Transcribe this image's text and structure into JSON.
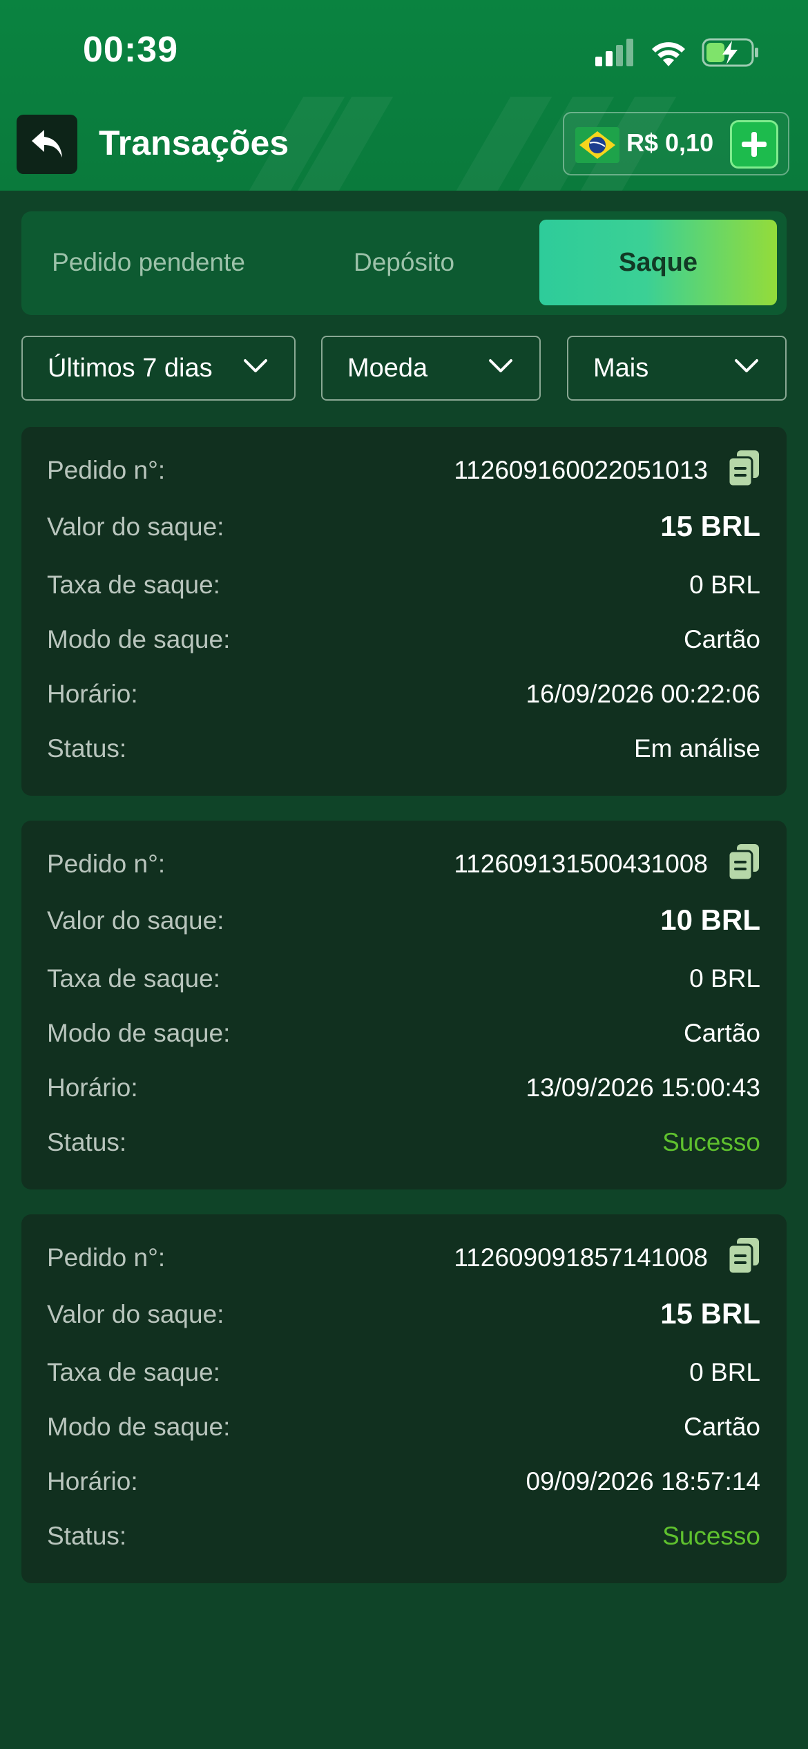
{
  "status_bar": {
    "time": "00:39"
  },
  "header": {
    "title": "Transações",
    "balance": "R$ 0,10",
    "back_icon": "back-arrow-icon",
    "add_icon": "plus-icon"
  },
  "tabs": [
    {
      "label": "Pedido pendente",
      "active": false
    },
    {
      "label": "Depósito",
      "active": false
    },
    {
      "label": "Saque",
      "active": true
    }
  ],
  "filters": [
    {
      "label": "Últimos 7 dias"
    },
    {
      "label": "Moeda"
    },
    {
      "label": "Mais"
    }
  ],
  "labels": {
    "order": "Pedido n°:",
    "amount": "Valor do saque:",
    "fee": "Taxa de saque:",
    "mode": "Modo de saque:",
    "time": "Horário:",
    "status": "Status:"
  },
  "transactions": [
    {
      "order": "112609160022051013",
      "amount": "15 BRL",
      "fee": "0 BRL",
      "mode": "Cartão",
      "time": "16/09/2026 00:22:06",
      "status": "Em análise"
    },
    {
      "order": "112609131500431008",
      "amount": "10 BRL",
      "fee": "0 BRL",
      "mode": "Cartão",
      "time": "13/09/2026 15:00:43",
      "status": "Sucesso"
    },
    {
      "order": "112609091857141008",
      "amount": "15 BRL",
      "fee": "0 BRL",
      "mode": "Cartão",
      "time": "09/09/2026 18:57:14",
      "status": "Sucesso"
    }
  ],
  "colors": {
    "header": "#0a8340",
    "background": "#0f4428",
    "card": "#11301f",
    "success": "#5fc12e",
    "tab_active_start": "#2ecc9a",
    "tab_active_end": "#94dc3a"
  }
}
